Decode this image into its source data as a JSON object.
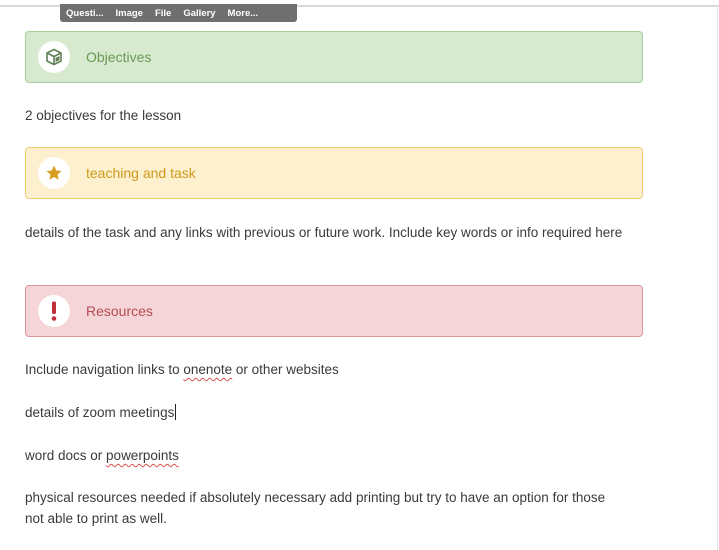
{
  "toolbar": {
    "items": [
      "Questi...",
      "Image",
      "File",
      "Gallery",
      "More..."
    ]
  },
  "callouts": {
    "objectives": {
      "title": "Objectives",
      "icon": "cube-icon",
      "color": "#6a9a55"
    },
    "teaching": {
      "title": "teaching and task",
      "icon": "star-icon",
      "color": "#cf9a1c"
    },
    "resources": {
      "title": "Resources",
      "icon": "exclamation-icon",
      "color": "#b54a54"
    }
  },
  "content": {
    "objectives_text": "2 objectives for the lesson",
    "teaching_text": "details of the task and any links with previous or future work.  Include key words or info required here",
    "resources_line1": {
      "before": "Include navigation links to ",
      "link_word": "onenote",
      "after": " or other websites"
    },
    "resources_line2": "details of zoom meetings",
    "resources_line3": {
      "before": "word docs or ",
      "link_word": "powerpoints"
    },
    "resources_line4": "physical resources needed if absolutely necessary add printing but try to have an option for those not able to print as well."
  }
}
